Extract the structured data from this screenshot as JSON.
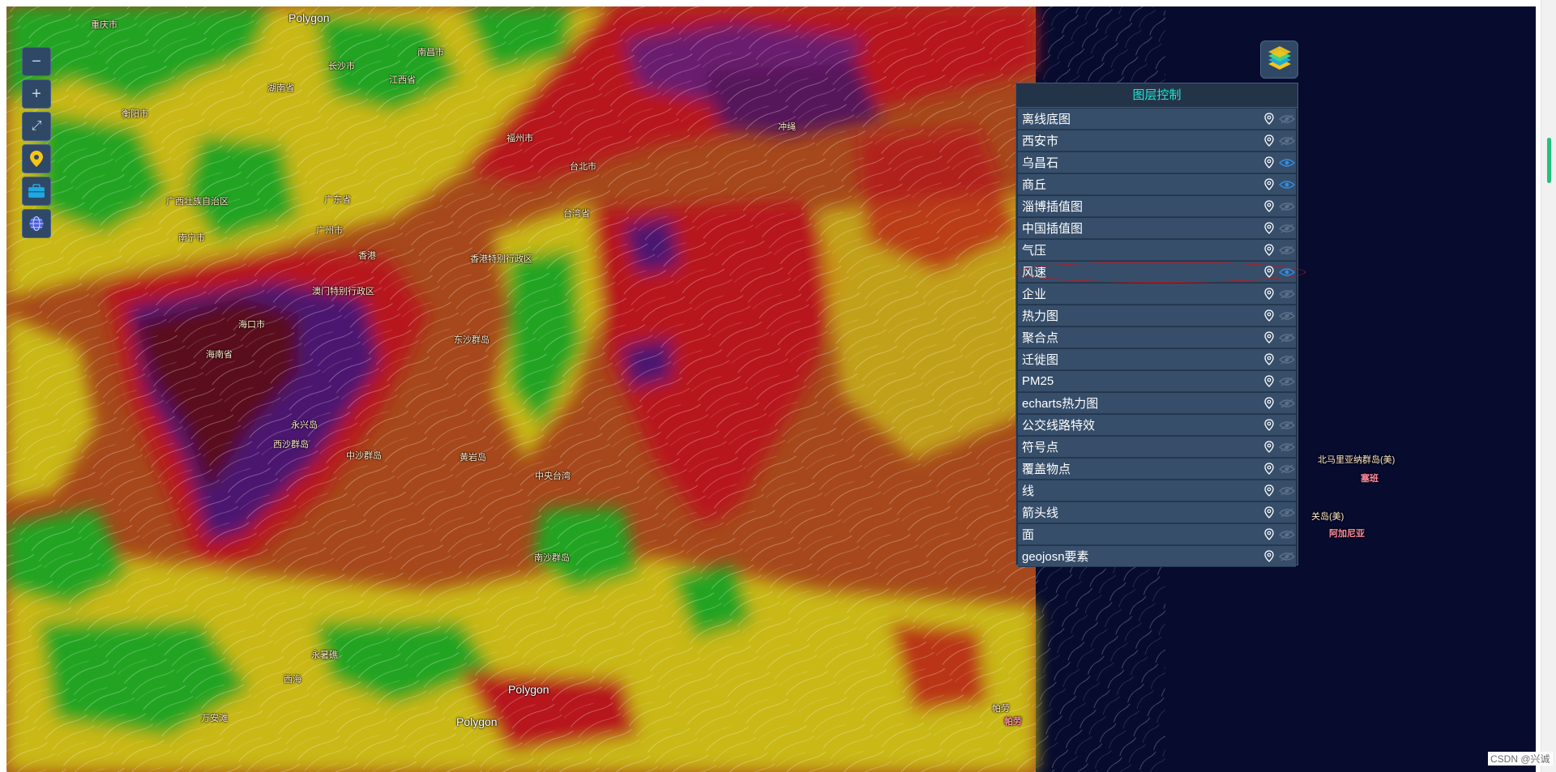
{
  "map": {
    "labels": [
      {
        "text": "Polygon",
        "style": "big"
      },
      {
        "text": "重庆市"
      },
      {
        "text": "长沙市"
      },
      {
        "text": "南昌市"
      },
      {
        "text": "江西省"
      },
      {
        "text": "湖南省"
      },
      {
        "text": "衡阳市"
      },
      {
        "text": "广西壮族自治区"
      },
      {
        "text": "南宁市"
      },
      {
        "text": "广州市"
      },
      {
        "text": "广东省"
      },
      {
        "text": "香港"
      },
      {
        "text": "香港特别行政区"
      },
      {
        "text": "澳门特别行政区"
      },
      {
        "text": "海口市"
      },
      {
        "text": "海南省"
      },
      {
        "text": "西沙群岛"
      },
      {
        "text": "永兴岛"
      },
      {
        "text": "中沙群岛"
      },
      {
        "text": "东沙群岛"
      },
      {
        "text": "福州市"
      },
      {
        "text": "台北市"
      },
      {
        "text": "台湾省"
      },
      {
        "text": "冲绳"
      },
      {
        "text": "黄岩岛"
      },
      {
        "text": "中央台湾"
      },
      {
        "text": "南沙群岛"
      },
      {
        "text": "永暑礁"
      },
      {
        "text": "西海"
      },
      {
        "text": "万安滩"
      },
      {
        "text": "Polygon",
        "style": "big"
      },
      {
        "text": "Polygon",
        "style": "big"
      },
      {
        "text": "帕劳"
      },
      {
        "text": "北马里亚纳群岛(美)"
      },
      {
        "text": "关岛(美)"
      },
      {
        "text": "塞班",
        "style": "pink"
      },
      {
        "text": "阿加尼亚",
        "style": "pink"
      },
      {
        "text": "帕劳",
        "style": "pink"
      }
    ]
  },
  "toolbar": {
    "buttons": [
      {
        "name": "zoom-out-button",
        "glyph": "−"
      },
      {
        "name": "zoom-in-button",
        "glyph": "+"
      },
      {
        "name": "fullscreen-button",
        "glyph": "⤢"
      },
      {
        "name": "location-button",
        "glyph": ""
      },
      {
        "name": "toolbox-button",
        "glyph": ""
      },
      {
        "name": "globe-button",
        "glyph": ""
      }
    ]
  },
  "layer_panel": {
    "title": "图层控制",
    "layers": [
      {
        "label": "离线底图",
        "visible": false
      },
      {
        "label": "西安市",
        "visible": false
      },
      {
        "label": "乌昌石",
        "visible": true
      },
      {
        "label": "商丘",
        "visible": true
      },
      {
        "label": "淄博插值图",
        "visible": false
      },
      {
        "label": "中国插值图",
        "visible": false
      },
      {
        "label": "气压",
        "visible": false
      },
      {
        "label": "风速",
        "visible": true
      },
      {
        "label": "企业",
        "visible": false
      },
      {
        "label": "热力图",
        "visible": false
      },
      {
        "label": "聚合点",
        "visible": false
      },
      {
        "label": "迁徙图",
        "visible": false
      },
      {
        "label": "PM25",
        "visible": false
      },
      {
        "label": "echarts热力图",
        "visible": false
      },
      {
        "label": "公交线路特效",
        "visible": false
      },
      {
        "label": "符号点",
        "visible": false
      },
      {
        "label": "覆盖物点",
        "visible": false
      },
      {
        "label": "线",
        "visible": false
      },
      {
        "label": "箭头线",
        "visible": false
      },
      {
        "label": "面",
        "visible": false
      },
      {
        "label": "geojosn要素",
        "visible": false
      }
    ]
  },
  "watermark": "CSDN @兴诚",
  "colors": {
    "panel_bg": "#233449",
    "row_bg": "#364e6a",
    "title": "#1de9d4",
    "eye_active": "#2f8fe8",
    "eye_inactive": "#5d7089",
    "highlight": "#c4161c"
  }
}
